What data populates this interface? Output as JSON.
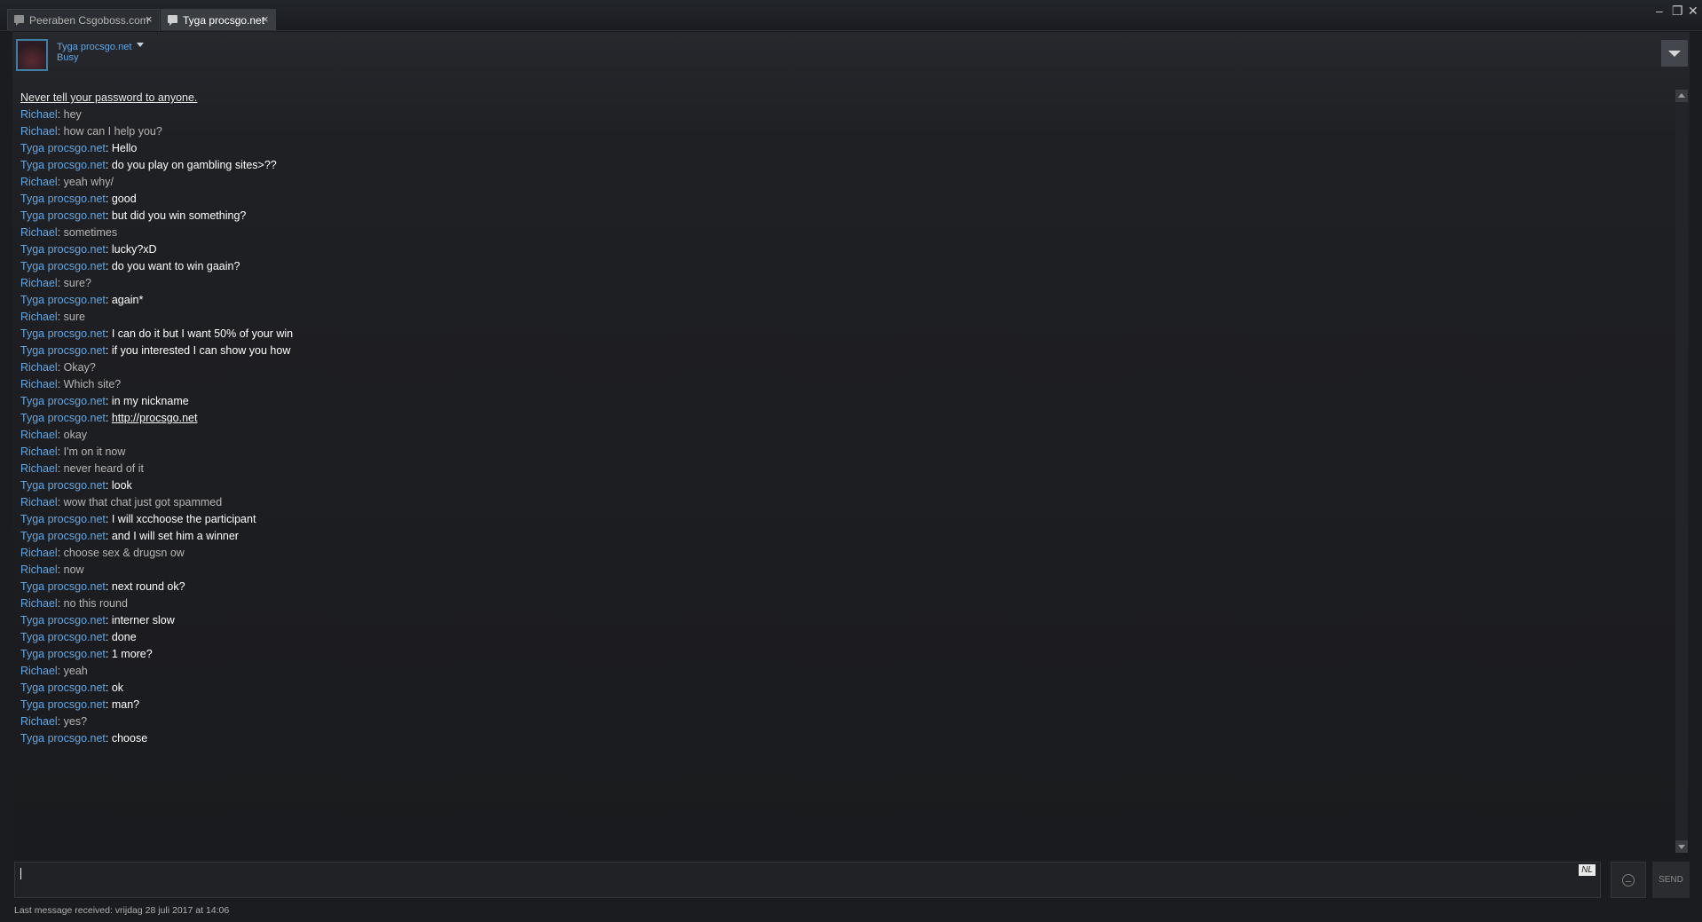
{
  "tabs": [
    {
      "label": "Peeraben Csgoboss.com",
      "close": "×"
    },
    {
      "label": "Tyga procsgo.net",
      "close": "×"
    }
  ],
  "window_controls": {
    "minimize": "‒",
    "restore": "❐",
    "close": "✕"
  },
  "header": {
    "name": "Tyga procsgo.net",
    "status": "Busy"
  },
  "chat": {
    "warning": "Never tell your password to anyone.",
    "messages": [
      {
        "sender": "Richael",
        "text": "hey",
        "self": true
      },
      {
        "sender": "Richael",
        "text": "how can I help you?",
        "self": true
      },
      {
        "sender": "Tyga procsgo.net",
        "text": "Hello",
        "self": false
      },
      {
        "sender": "Tyga procsgo.net",
        "text": "do you play on gambling sites>??",
        "self": false
      },
      {
        "sender": "Richael",
        "text": "yeah why/",
        "self": true
      },
      {
        "sender": "Tyga procsgo.net",
        "text": "good",
        "self": false
      },
      {
        "sender": "Tyga procsgo.net",
        "text": "but did you win something?",
        "self": false
      },
      {
        "sender": "Richael",
        "text": "sometimes",
        "self": true
      },
      {
        "sender": "Tyga procsgo.net",
        "text": "lucky?xD",
        "self": false
      },
      {
        "sender": "Tyga procsgo.net",
        "text": "do you want to win gaain?",
        "self": false
      },
      {
        "sender": "Richael",
        "text": "sure?",
        "self": true
      },
      {
        "sender": "Tyga procsgo.net",
        "text": "again*",
        "self": false
      },
      {
        "sender": "Richael",
        "text": "sure",
        "self": true
      },
      {
        "sender": "Tyga procsgo.net",
        "text": "I can do it but I want 50% of your win",
        "self": false
      },
      {
        "sender": "Tyga procsgo.net",
        "text": "if you interested I can show you how",
        "self": false
      },
      {
        "sender": "Richael",
        "text": "Okay?",
        "self": true
      },
      {
        "sender": "Richael",
        "text": "Which site?",
        "self": true
      },
      {
        "sender": "Tyga procsgo.net",
        "text": "in my nickname",
        "self": false
      },
      {
        "sender": "Tyga procsgo.net",
        "text": "http://procsgo.net",
        "self": false,
        "link": true
      },
      {
        "sender": "Richael",
        "text": "okay",
        "self": true
      },
      {
        "sender": "Richael",
        "text": "I'm on it now",
        "self": true
      },
      {
        "sender": "Richael",
        "text": "never heard of it",
        "self": true
      },
      {
        "sender": "Tyga procsgo.net",
        "text": "look",
        "self": false
      },
      {
        "sender": "Richael",
        "text": "wow that chat just got spammed",
        "self": true
      },
      {
        "sender": "Tyga procsgo.net",
        "text": "I will xcchoose the participant",
        "self": false
      },
      {
        "sender": "Tyga procsgo.net",
        "text": "and I will set him a winner",
        "self": false
      },
      {
        "sender": "Richael",
        "text": "choose sex & drugsn ow",
        "self": true
      },
      {
        "sender": "Richael",
        "text": "now",
        "self": true
      },
      {
        "sender": "Tyga procsgo.net",
        "text": "next round ok?",
        "self": false
      },
      {
        "sender": "Richael",
        "text": "no this round",
        "self": true
      },
      {
        "sender": "Tyga procsgo.net",
        "text": "interner slow",
        "self": false
      },
      {
        "sender": "Tyga procsgo.net",
        "text": "done",
        "self": false
      },
      {
        "sender": "Tyga procsgo.net",
        "text": "1 more?",
        "self": false
      },
      {
        "sender": "Richael",
        "text": "yeah",
        "self": true
      },
      {
        "sender": "Tyga procsgo.net",
        "text": "ok",
        "self": false
      },
      {
        "sender": "Tyga procsgo.net",
        "text": "man?",
        "self": false
      },
      {
        "sender": "Richael",
        "text": "yes?",
        "self": true
      },
      {
        "sender": "Tyga procsgo.net",
        "text": "choose",
        "self": false
      }
    ]
  },
  "input": {
    "value": "",
    "language_badge": "NL"
  },
  "send_label": "SEND",
  "footer": "Last message received: vrijdag 28 juli 2017 at 14:06"
}
